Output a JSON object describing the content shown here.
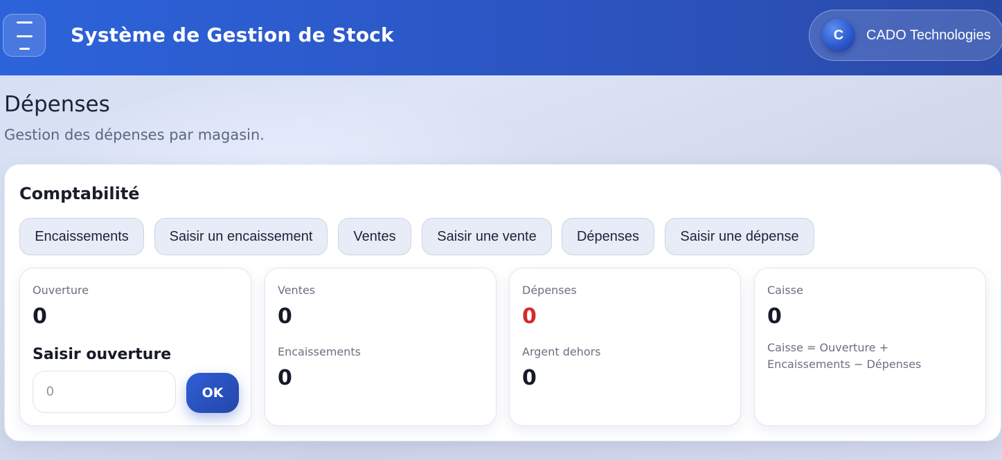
{
  "header": {
    "app_title": "Système de Gestion de Stock",
    "company_initial": "C",
    "company_name": "CADO Technologies"
  },
  "page": {
    "title": "Dépenses",
    "subtitle": "Gestion des dépenses par magasin."
  },
  "section": {
    "title": "Comptabilité",
    "tabs": [
      "Encaissements",
      "Saisir un encaissement",
      "Ventes",
      "Saisir une vente",
      "Dépenses",
      "Saisir une dépense"
    ]
  },
  "stats": {
    "ouverture": {
      "label": "Ouverture",
      "value": "0",
      "input_title": "Saisir ouverture",
      "input_placeholder": "0",
      "ok_label": "OK"
    },
    "ventes": {
      "label": "Ventes",
      "value": "0",
      "sub_label": "Encaissements",
      "sub_value": "0"
    },
    "depenses": {
      "label": "Dépenses",
      "value": "0",
      "sub_label": "Argent dehors",
      "sub_value": "0"
    },
    "caisse": {
      "label": "Caisse",
      "value": "0",
      "formula": "Caisse = Ouverture + Encaissements − Dépenses"
    }
  },
  "colors": {
    "header_start": "#2c63db",
    "header_end": "#2a4aa8",
    "negative": "#d42a2a",
    "button": "#2546a8"
  },
  "icons": {
    "menu": "hamburger-menu-icon"
  }
}
